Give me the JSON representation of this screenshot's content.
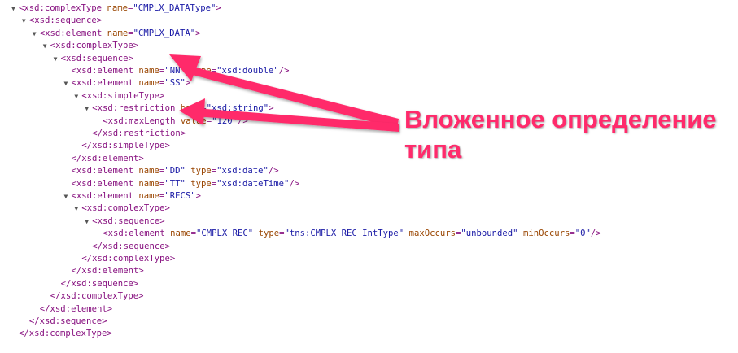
{
  "xml_viewer": {
    "lines": [
      {
        "indent": 0,
        "toggle": "▼",
        "parts": [
          {
            "c": "tag",
            "t": "<xsd:complexType "
          },
          {
            "c": "an",
            "t": "name"
          },
          {
            "c": "tag",
            "t": "="
          },
          {
            "c": "av",
            "t": "\"CMPLX_DATAType\""
          },
          {
            "c": "tag",
            "t": ">"
          }
        ]
      },
      {
        "indent": 1,
        "toggle": "▼",
        "parts": [
          {
            "c": "tag",
            "t": "<xsd:sequence>"
          }
        ]
      },
      {
        "indent": 2,
        "toggle": "▼",
        "parts": [
          {
            "c": "tag",
            "t": "<xsd:element "
          },
          {
            "c": "an",
            "t": "name"
          },
          {
            "c": "tag",
            "t": "="
          },
          {
            "c": "av",
            "t": "\"CMPLX_DATA\""
          },
          {
            "c": "tag",
            "t": ">"
          }
        ]
      },
      {
        "indent": 3,
        "toggle": "▼",
        "parts": [
          {
            "c": "tag",
            "t": "<xsd:complexType>"
          }
        ]
      },
      {
        "indent": 4,
        "toggle": "▼",
        "parts": [
          {
            "c": "tag",
            "t": "<xsd:sequence>"
          }
        ]
      },
      {
        "indent": 5,
        "toggle": "",
        "parts": [
          {
            "c": "tag",
            "t": "<xsd:element "
          },
          {
            "c": "an",
            "t": "name"
          },
          {
            "c": "tag",
            "t": "="
          },
          {
            "c": "av",
            "t": "\"NN\""
          },
          {
            "c": "tag",
            "t": " "
          },
          {
            "c": "an",
            "t": "type"
          },
          {
            "c": "tag",
            "t": "="
          },
          {
            "c": "av",
            "t": "\"xsd:double\""
          },
          {
            "c": "tag",
            "t": "/>"
          }
        ]
      },
      {
        "indent": 5,
        "toggle": "▼",
        "parts": [
          {
            "c": "tag",
            "t": "<xsd:element "
          },
          {
            "c": "an",
            "t": "name"
          },
          {
            "c": "tag",
            "t": "="
          },
          {
            "c": "av",
            "t": "\"SS\""
          },
          {
            "c": "tag",
            "t": ">"
          }
        ]
      },
      {
        "indent": 6,
        "toggle": "▼",
        "parts": [
          {
            "c": "tag",
            "t": "<xsd:simpleType>"
          }
        ]
      },
      {
        "indent": 7,
        "toggle": "▼",
        "parts": [
          {
            "c": "tag",
            "t": "<xsd:restriction "
          },
          {
            "c": "an",
            "t": "base"
          },
          {
            "c": "tag",
            "t": "="
          },
          {
            "c": "av",
            "t": "\"xsd:string\""
          },
          {
            "c": "tag",
            "t": ">"
          }
        ]
      },
      {
        "indent": 8,
        "toggle": "",
        "parts": [
          {
            "c": "tag",
            "t": "<xsd:maxLength "
          },
          {
            "c": "an",
            "t": "value"
          },
          {
            "c": "tag",
            "t": "="
          },
          {
            "c": "av",
            "t": "\"120\""
          },
          {
            "c": "tag",
            "t": "/>"
          }
        ]
      },
      {
        "indent": 7,
        "toggle": "",
        "parts": [
          {
            "c": "tag",
            "t": "</xsd:restriction>"
          }
        ]
      },
      {
        "indent": 6,
        "toggle": "",
        "parts": [
          {
            "c": "tag",
            "t": "</xsd:simpleType>"
          }
        ]
      },
      {
        "indent": 5,
        "toggle": "",
        "parts": [
          {
            "c": "tag",
            "t": "</xsd:element>"
          }
        ]
      },
      {
        "indent": 5,
        "toggle": "",
        "parts": [
          {
            "c": "tag",
            "t": "<xsd:element "
          },
          {
            "c": "an",
            "t": "name"
          },
          {
            "c": "tag",
            "t": "="
          },
          {
            "c": "av",
            "t": "\"DD\""
          },
          {
            "c": "tag",
            "t": " "
          },
          {
            "c": "an",
            "t": "type"
          },
          {
            "c": "tag",
            "t": "="
          },
          {
            "c": "av",
            "t": "\"xsd:date\""
          },
          {
            "c": "tag",
            "t": "/>"
          }
        ]
      },
      {
        "indent": 5,
        "toggle": "",
        "parts": [
          {
            "c": "tag",
            "t": "<xsd:element "
          },
          {
            "c": "an",
            "t": "name"
          },
          {
            "c": "tag",
            "t": "="
          },
          {
            "c": "av",
            "t": "\"TT\""
          },
          {
            "c": "tag",
            "t": " "
          },
          {
            "c": "an",
            "t": "type"
          },
          {
            "c": "tag",
            "t": "="
          },
          {
            "c": "av",
            "t": "\"xsd:dateTime\""
          },
          {
            "c": "tag",
            "t": "/>"
          }
        ]
      },
      {
        "indent": 5,
        "toggle": "▼",
        "parts": [
          {
            "c": "tag",
            "t": "<xsd:element "
          },
          {
            "c": "an",
            "t": "name"
          },
          {
            "c": "tag",
            "t": "="
          },
          {
            "c": "av",
            "t": "\"RECS\""
          },
          {
            "c": "tag",
            "t": ">"
          }
        ]
      },
      {
        "indent": 6,
        "toggle": "▼",
        "parts": [
          {
            "c": "tag",
            "t": "<xsd:complexType>"
          }
        ]
      },
      {
        "indent": 7,
        "toggle": "▼",
        "parts": [
          {
            "c": "tag",
            "t": "<xsd:sequence>"
          }
        ]
      },
      {
        "indent": 8,
        "toggle": "",
        "parts": [
          {
            "c": "tag",
            "t": "<xsd:element "
          },
          {
            "c": "an",
            "t": "name"
          },
          {
            "c": "tag",
            "t": "="
          },
          {
            "c": "av",
            "t": "\"CMPLX_REC\""
          },
          {
            "c": "tag",
            "t": " "
          },
          {
            "c": "an",
            "t": "type"
          },
          {
            "c": "tag",
            "t": "="
          },
          {
            "c": "av",
            "t": "\"tns:CMPLX_REC_IntType\""
          },
          {
            "c": "tag",
            "t": " "
          },
          {
            "c": "an",
            "t": "maxOccurs"
          },
          {
            "c": "tag",
            "t": "="
          },
          {
            "c": "av",
            "t": "\"unbounded\""
          },
          {
            "c": "tag",
            "t": " "
          },
          {
            "c": "an",
            "t": "minOccurs"
          },
          {
            "c": "tag",
            "t": "="
          },
          {
            "c": "av",
            "t": "\"0\""
          },
          {
            "c": "tag",
            "t": "/>"
          }
        ]
      },
      {
        "indent": 7,
        "toggle": "",
        "parts": [
          {
            "c": "tag",
            "t": "</xsd:sequence>"
          }
        ]
      },
      {
        "indent": 6,
        "toggle": "",
        "parts": [
          {
            "c": "tag",
            "t": "</xsd:complexType>"
          }
        ]
      },
      {
        "indent": 5,
        "toggle": "",
        "parts": [
          {
            "c": "tag",
            "t": "</xsd:element>"
          }
        ]
      },
      {
        "indent": 4,
        "toggle": "",
        "parts": [
          {
            "c": "tag",
            "t": "</xsd:sequence>"
          }
        ]
      },
      {
        "indent": 3,
        "toggle": "",
        "parts": [
          {
            "c": "tag",
            "t": "</xsd:complexType>"
          }
        ]
      },
      {
        "indent": 2,
        "toggle": "",
        "parts": [
          {
            "c": "tag",
            "t": "</xsd:element>"
          }
        ]
      },
      {
        "indent": 1,
        "toggle": "",
        "parts": [
          {
            "c": "tag",
            "t": "</xsd:sequence>"
          }
        ]
      },
      {
        "indent": 0,
        "toggle": "",
        "parts": [
          {
            "c": "tag",
            "t": "</xsd:complexType>"
          }
        ]
      }
    ]
  },
  "annotation": {
    "text": "Вложенное определение типа",
    "color": "#ff2a6b",
    "arrow_icon": "arrow-icon"
  },
  "colors": {
    "tag": "#881280",
    "attr_name": "#994500",
    "attr_value": "#1a1aa6",
    "toggle": "#555555"
  }
}
